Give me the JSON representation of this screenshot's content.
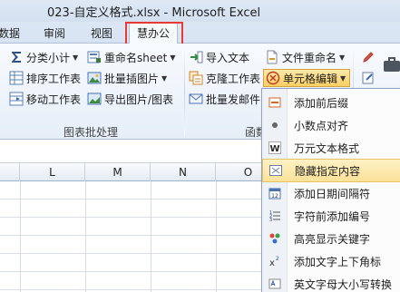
{
  "window": {
    "title": "023-自定义格式.xlsx  -  Microsoft Excel"
  },
  "tabs": [
    {
      "label": "数据"
    },
    {
      "label": "审阅"
    },
    {
      "label": "视图"
    },
    {
      "label": "慧办公",
      "active": true
    }
  ],
  "ribbon": {
    "group1": {
      "label": "图表批处理",
      "buttons": [
        {
          "label": "分类小计",
          "icon": "sigma-icon",
          "has_dropdown": true
        },
        {
          "label": "重命名sheet",
          "icon": "rename-sheet-icon",
          "has_dropdown": true
        },
        {
          "label": "排序工作表",
          "icon": "sort-sheets-icon"
        },
        {
          "label": "批量插图片",
          "icon": "insert-pictures-icon",
          "has_dropdown": true
        },
        {
          "label": "移动工作表",
          "icon": "move-sheets-icon"
        },
        {
          "label": "导出图片/图表",
          "icon": "export-picture-icon"
        }
      ]
    },
    "group2": {
      "label": "函数",
      "buttons": [
        {
          "label": "导入文本",
          "icon": "import-text-icon"
        },
        {
          "label": "文件重命名",
          "icon": "file-rename-icon",
          "has_dropdown": true
        },
        {
          "label": "克隆工作表",
          "icon": "clone-sheet-icon"
        },
        {
          "label": "单元格编辑",
          "icon": "cell-edit-icon",
          "has_dropdown": true,
          "active": true
        },
        {
          "label": "批量发邮件",
          "icon": "mail-icon"
        }
      ]
    }
  },
  "sheet": {
    "columns": [
      "L",
      "M",
      "N",
      "O"
    ]
  },
  "menu": {
    "items": [
      {
        "label": "添加前后缀",
        "icon": "add-prefix-suffix-icon"
      },
      {
        "label": "小数点对齐",
        "icon": "decimal-dot-icon"
      },
      {
        "label": "万元文本格式",
        "icon": "word-w-icon"
      },
      {
        "label": "隐藏指定内容",
        "icon": "hide-content-icon",
        "highlighted": true
      },
      {
        "label": "添加日期间隔符",
        "icon": "date-separator-icon"
      },
      {
        "label": "字符前添加编号",
        "icon": "numbering-icon"
      },
      {
        "label": "高亮显示关键字",
        "icon": "highlight-keyword-icon"
      },
      {
        "label": "添加文字上下角标",
        "icon": "superscript-icon"
      },
      {
        "label": "英文字母大小写转换",
        "icon": "case-convert-icon"
      }
    ]
  },
  "colors": {
    "highlight_border": "#e53a36",
    "active_button": "#f9cf63",
    "menu_hover": "#fbe29a"
  }
}
